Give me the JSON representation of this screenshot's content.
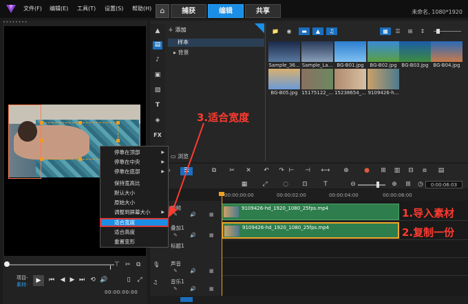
{
  "titlebar": {
    "menus": [
      "文件(F)",
      "编辑(E)",
      "工具(T)",
      "设置(S)",
      "帮助(H)"
    ],
    "home_icon": "home-icon",
    "tabs": [
      {
        "label": "捕获",
        "active": false
      },
      {
        "label": "编辑",
        "active": true
      },
      {
        "label": "共享",
        "active": false
      }
    ],
    "project": "未命名, 1080*1920"
  },
  "library": {
    "add_label": "添加",
    "folders": [
      "样本",
      "背景"
    ],
    "browse_label": "浏览",
    "media": [
      {
        "label": "Sample_36..."
      },
      {
        "label": "Sample_La..."
      },
      {
        "label": "BG-B01.jpg"
      },
      {
        "label": "BG-B02.jpg"
      },
      {
        "label": "BG-B03.jpg"
      },
      {
        "label": "BG-B04.jpg"
      },
      {
        "label": "BG-B05.jpg"
      },
      {
        "label": "15175122_..."
      },
      {
        "label": "15238654_..."
      },
      {
        "label": "9109426-h..."
      }
    ]
  },
  "context_menu": {
    "items": [
      {
        "label": "停靠在顶部",
        "submenu": true,
        "selected": false
      },
      {
        "label": "停靠在中央",
        "submenu": true,
        "selected": false
      },
      {
        "label": "停靠在底部",
        "submenu": true,
        "selected": false
      },
      {
        "label": "保持宽高比",
        "submenu": false,
        "selected": false
      },
      {
        "label": "默认大小",
        "submenu": false,
        "selected": false
      },
      {
        "label": "原始大小",
        "submenu": false,
        "selected": false
      },
      {
        "label": "调整到屏幕大小",
        "submenu": true,
        "selected": false
      },
      {
        "label": "适合宽度",
        "submenu": false,
        "selected": true
      },
      {
        "label": "适合高度",
        "submenu": false,
        "selected": false
      },
      {
        "label": "重置变形",
        "submenu": false,
        "selected": false
      }
    ]
  },
  "preview": {
    "project_label": "项目-",
    "material_label": "素材-",
    "timecode": "00:00:00:00"
  },
  "timeline": {
    "counter": "0:00:06:03",
    "ruler": [
      "00:00:00:00",
      "00:00:02:00",
      "00:00:04:00",
      "00:00:06:00"
    ],
    "tracks": [
      {
        "name": "视频",
        "clip": "9109426-hd_1920_1080_25fps.mp4"
      },
      {
        "name": "叠加1",
        "clip": "9109426-hd_1920_1080_25fps.mp4"
      },
      {
        "name": "标题1",
        "clip": ""
      },
      {
        "name": "声音",
        "clip": ""
      },
      {
        "name": "音乐1",
        "clip": ""
      }
    ]
  },
  "annotations": {
    "step3": "3.适合宽度",
    "step1": "1.导入素材",
    "step2": "2.复制一份"
  },
  "colors": {
    "accent": "#1b8ee6",
    "annotation": "#ff3b30",
    "clip": "#2e7d4c",
    "selected_clip_border": "#f2a72b"
  }
}
